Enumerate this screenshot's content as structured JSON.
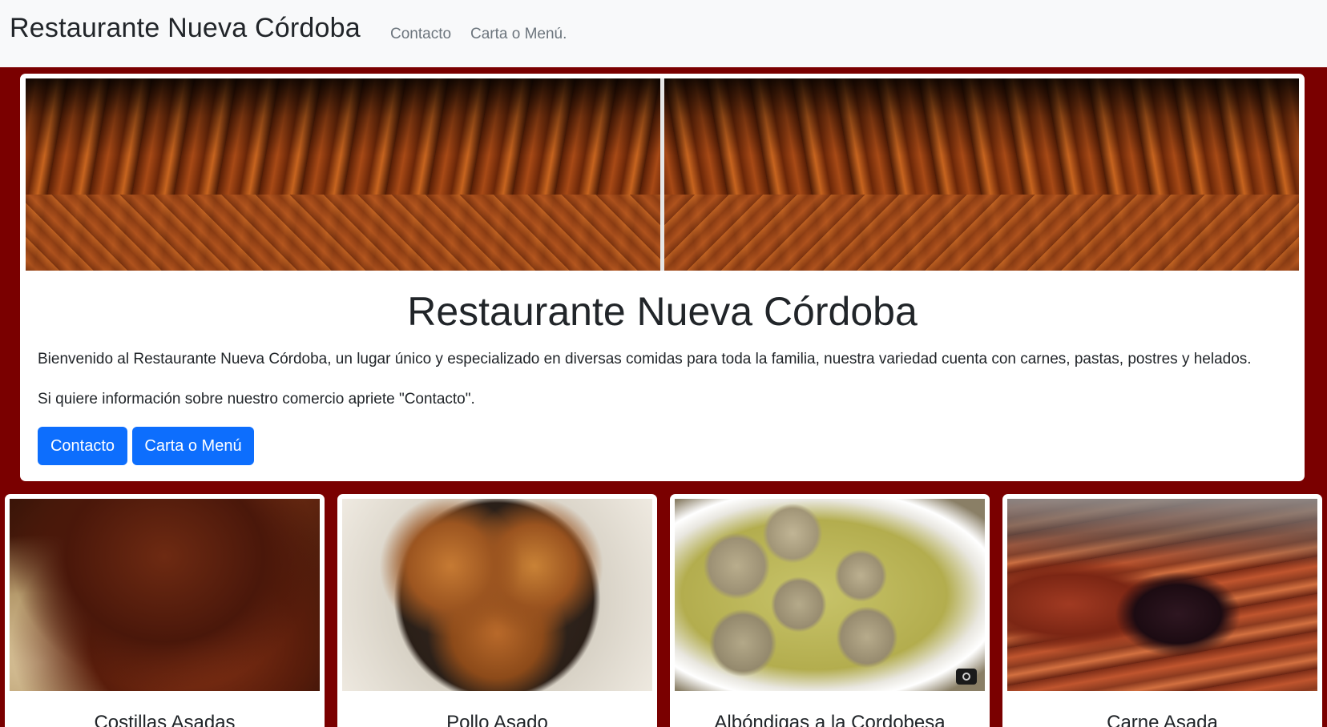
{
  "navbar": {
    "brand": "Restaurante Nueva Córdoba",
    "links": [
      "Contacto",
      "Carta o Menú."
    ]
  },
  "hero": {
    "title": "Restaurante Nueva Córdoba",
    "intro": "Bienvenido al Restaurante Nueva Córdoba, un lugar único y especializado en diversas comidas para toda la familia, nuestra variedad cuenta con carnes, pastas, postres y helados.",
    "contact_hint": "Si quiere información sobre nuestro comercio apriete \"Contacto\".",
    "buttons": {
      "contacto": "Contacto",
      "menu": "Carta o Menú"
    }
  },
  "dishes": [
    {
      "title": "Costillas Asadas"
    },
    {
      "title": "Pollo Asado"
    },
    {
      "title": "Albóndigas a la Cordobesa"
    },
    {
      "title": "Carne Asada"
    }
  ],
  "colors": {
    "page_background": "#7a0000",
    "navbar_background": "#f8f9fa",
    "button_primary": "#0d6efd"
  }
}
